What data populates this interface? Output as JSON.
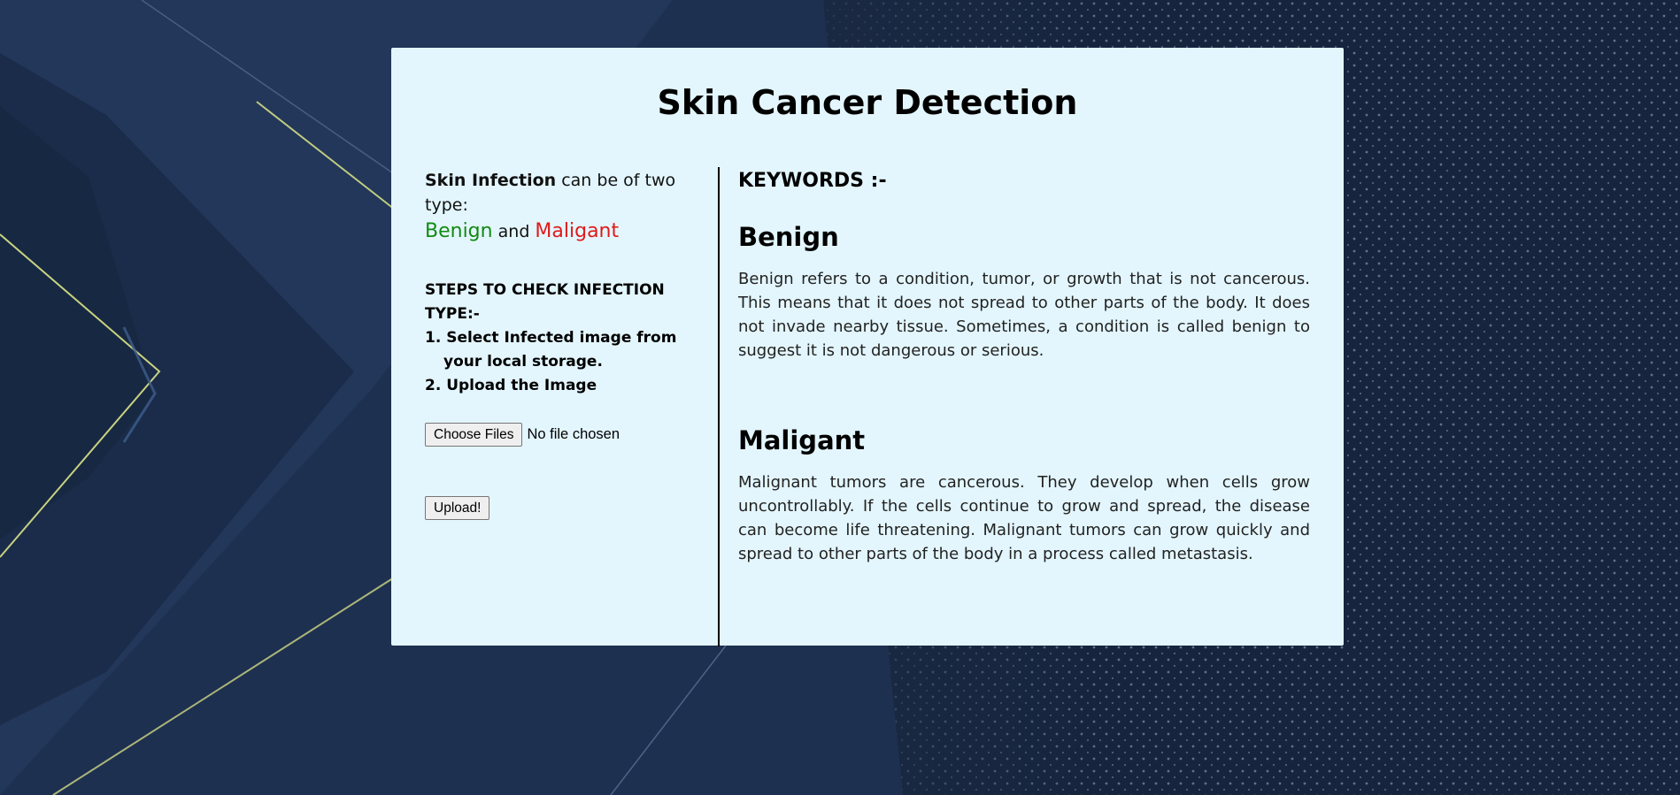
{
  "page": {
    "title": "Skin Cancer Detection"
  },
  "left": {
    "intro_bold": "Skin Infection",
    "intro_rest": " can be of two type:",
    "type_benign": "Benign",
    "type_and": " and ",
    "type_malignant": "Maligant",
    "steps_title": "STEPS TO CHECK INFECTION TYPE:-",
    "steps": [
      "1. Select Infected image from your local storage.",
      "2. Upload the Image"
    ],
    "choose_files_label": "Choose Files",
    "file_status": "No file chosen",
    "upload_label": "Upload!"
  },
  "right": {
    "keywords_title": "KEYWORDS :-",
    "benign_title": "Benign",
    "benign_desc": "Benign refers to a condition, tumor, or growth that is not cancerous. This means that it does not spread to other parts of the body. It does not invade nearby tissue. Sometimes, a condition is called benign to suggest it is not dangerous or serious.",
    "malignant_title": "Maligant",
    "malignant_desc": "Malignant tumors are cancerous. They develop when cells grow uncontrollably. If the cells continue to grow and spread, the disease can become life threatening. Malignant tumors can grow quickly and spread to other parts of the body in a process called metastasis."
  },
  "colors": {
    "card_background": "#e3f6fd",
    "benign": "#138a13",
    "malignant": "#e01a1a",
    "page_background": "#1b2a44"
  }
}
